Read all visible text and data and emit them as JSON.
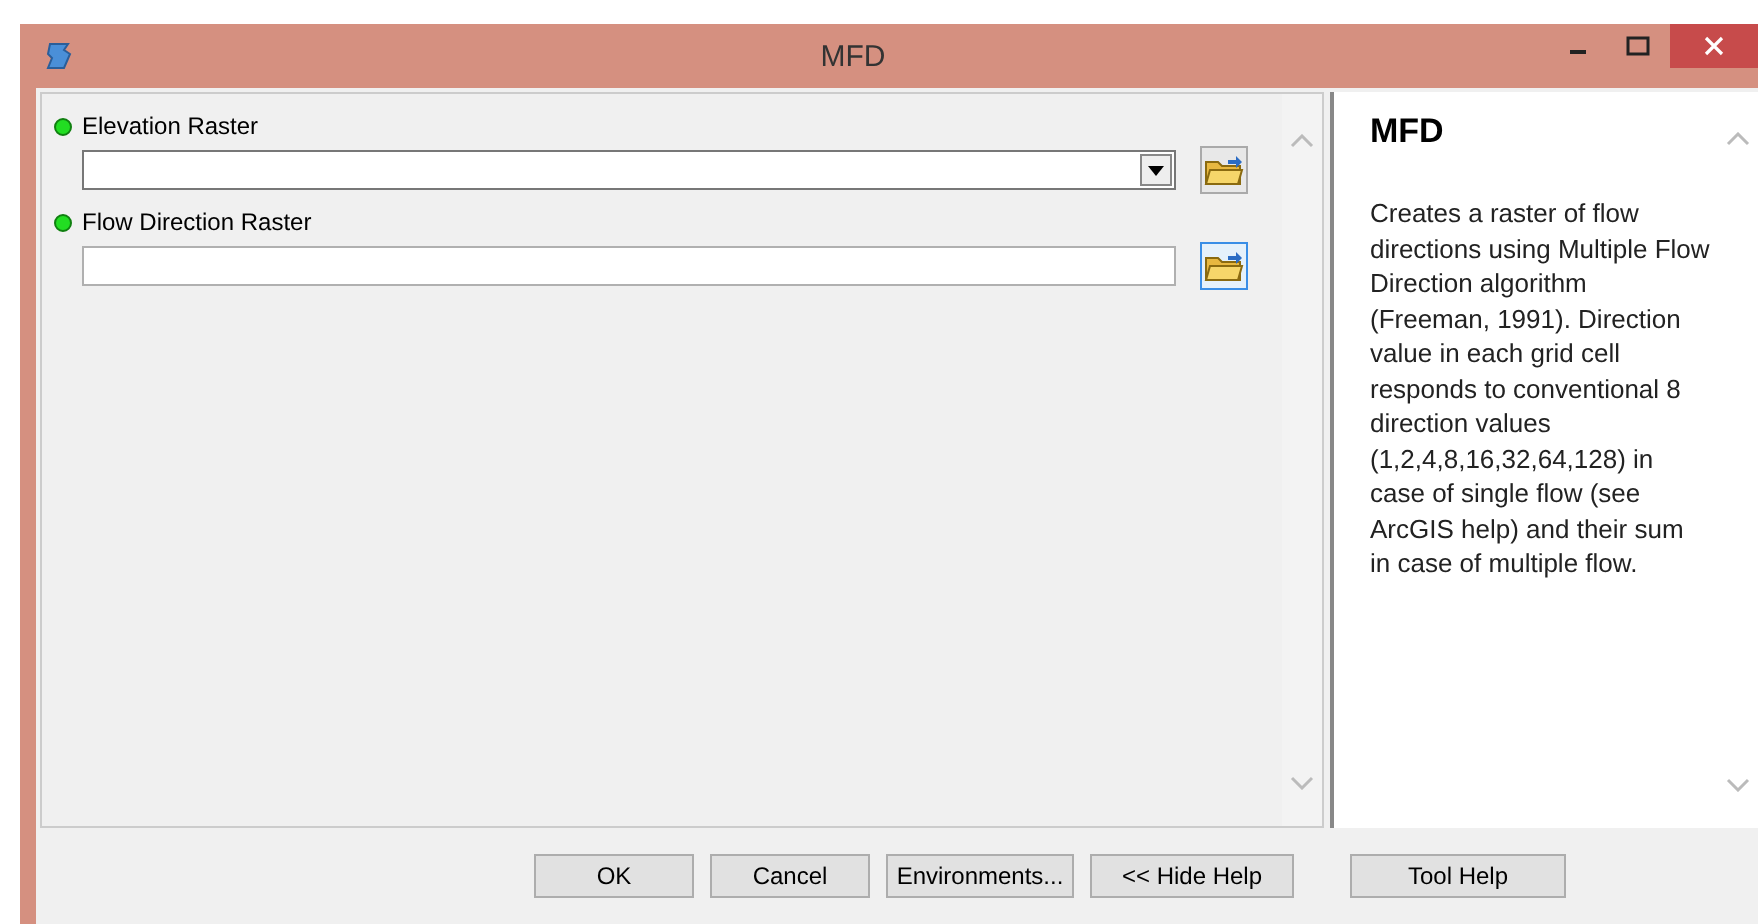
{
  "window": {
    "title": "MFD"
  },
  "parameters": [
    {
      "label": "Elevation Raster",
      "kind": "dropdown",
      "required": true,
      "browse_focused": false
    },
    {
      "label": "Flow Direction Raster",
      "kind": "text",
      "required": true,
      "browse_focused": true
    }
  ],
  "help": {
    "title": "MFD",
    "text": "Creates a raster of flow directions using Multiple Flow Direction algorithm (Freeman, 1991). Direction value in each grid cell responds to conventional 8 direction values (1,2,4,8,16,32,64,128) in case of single flow (see ArcGIS help) and their sum in case of multiple flow."
  },
  "buttons": [
    "OK",
    "Cancel",
    "Environments...",
    "<< Hide Help",
    "Tool Help"
  ]
}
